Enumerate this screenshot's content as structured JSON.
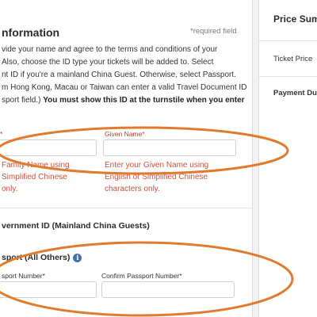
{
  "section": {
    "title": "nformation",
    "required_note": "*required field"
  },
  "intro": {
    "line1": "vide your name and agree to the terms and conditions of your",
    "line2": "Also, choose the ID type your tickets will be added to. Select",
    "line3": "nt ID if you're a mainland China Guest. Otherwise, select Passport.",
    "line4": "m Hong Kong, Macau or Taiwan can enter a valid Travel Document ID",
    "line5_normal": "sport field.) ",
    "line5_bold": "You must show this ID at the turnstile when you enter"
  },
  "name_fields": {
    "family_label": "*",
    "given_label": "Given Name*",
    "family_error": [
      "Family Name using",
      "Simplified Chinese",
      "only."
    ],
    "given_error": [
      "Enter your Given Name using",
      "English or Simplified Chinese",
      "characters only."
    ]
  },
  "id_options": {
    "government_id": "vernment ID (Mainland China Guests)",
    "passport": "sport (All Others)",
    "info_icon_glyph": "i"
  },
  "passport_fields": {
    "number_label": "sport Number*",
    "confirm_label": "Confirm Passport Number*"
  },
  "sidebar": {
    "title": "Price Sum",
    "ticket_price": "Ticket Price",
    "payment_due": "Payment Du"
  },
  "colors": {
    "annotation_orange": "#e07b2e",
    "error_red": "#d0503e",
    "info_blue": "#4a6fa5"
  }
}
